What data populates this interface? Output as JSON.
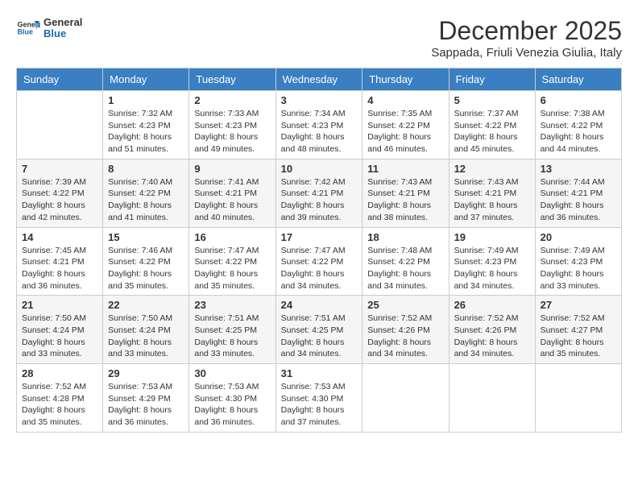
{
  "header": {
    "logo_general": "General",
    "logo_blue": "Blue",
    "month_title": "December 2025",
    "location": "Sappada, Friuli Venezia Giulia, Italy"
  },
  "days_of_week": [
    "Sunday",
    "Monday",
    "Tuesday",
    "Wednesday",
    "Thursday",
    "Friday",
    "Saturday"
  ],
  "weeks": [
    [
      {
        "day": "",
        "sunrise": "",
        "sunset": "",
        "daylight": ""
      },
      {
        "day": "1",
        "sunrise": "7:32 AM",
        "sunset": "4:23 PM",
        "daylight": "8 hours and 51 minutes."
      },
      {
        "day": "2",
        "sunrise": "7:33 AM",
        "sunset": "4:23 PM",
        "daylight": "8 hours and 49 minutes."
      },
      {
        "day": "3",
        "sunrise": "7:34 AM",
        "sunset": "4:23 PM",
        "daylight": "8 hours and 48 minutes."
      },
      {
        "day": "4",
        "sunrise": "7:35 AM",
        "sunset": "4:22 PM",
        "daylight": "8 hours and 46 minutes."
      },
      {
        "day": "5",
        "sunrise": "7:37 AM",
        "sunset": "4:22 PM",
        "daylight": "8 hours and 45 minutes."
      },
      {
        "day": "6",
        "sunrise": "7:38 AM",
        "sunset": "4:22 PM",
        "daylight": "8 hours and 44 minutes."
      }
    ],
    [
      {
        "day": "7",
        "sunrise": "7:39 AM",
        "sunset": "4:22 PM",
        "daylight": "8 hours and 42 minutes."
      },
      {
        "day": "8",
        "sunrise": "7:40 AM",
        "sunset": "4:22 PM",
        "daylight": "8 hours and 41 minutes."
      },
      {
        "day": "9",
        "sunrise": "7:41 AM",
        "sunset": "4:21 PM",
        "daylight": "8 hours and 40 minutes."
      },
      {
        "day": "10",
        "sunrise": "7:42 AM",
        "sunset": "4:21 PM",
        "daylight": "8 hours and 39 minutes."
      },
      {
        "day": "11",
        "sunrise": "7:43 AM",
        "sunset": "4:21 PM",
        "daylight": "8 hours and 38 minutes."
      },
      {
        "day": "12",
        "sunrise": "7:43 AM",
        "sunset": "4:21 PM",
        "daylight": "8 hours and 37 minutes."
      },
      {
        "day": "13",
        "sunrise": "7:44 AM",
        "sunset": "4:21 PM",
        "daylight": "8 hours and 36 minutes."
      }
    ],
    [
      {
        "day": "14",
        "sunrise": "7:45 AM",
        "sunset": "4:21 PM",
        "daylight": "8 hours and 36 minutes."
      },
      {
        "day": "15",
        "sunrise": "7:46 AM",
        "sunset": "4:22 PM",
        "daylight": "8 hours and 35 minutes."
      },
      {
        "day": "16",
        "sunrise": "7:47 AM",
        "sunset": "4:22 PM",
        "daylight": "8 hours and 35 minutes."
      },
      {
        "day": "17",
        "sunrise": "7:47 AM",
        "sunset": "4:22 PM",
        "daylight": "8 hours and 34 minutes."
      },
      {
        "day": "18",
        "sunrise": "7:48 AM",
        "sunset": "4:22 PM",
        "daylight": "8 hours and 34 minutes."
      },
      {
        "day": "19",
        "sunrise": "7:49 AM",
        "sunset": "4:23 PM",
        "daylight": "8 hours and 34 minutes."
      },
      {
        "day": "20",
        "sunrise": "7:49 AM",
        "sunset": "4:23 PM",
        "daylight": "8 hours and 33 minutes."
      }
    ],
    [
      {
        "day": "21",
        "sunrise": "7:50 AM",
        "sunset": "4:24 PM",
        "daylight": "8 hours and 33 minutes."
      },
      {
        "day": "22",
        "sunrise": "7:50 AM",
        "sunset": "4:24 PM",
        "daylight": "8 hours and 33 minutes."
      },
      {
        "day": "23",
        "sunrise": "7:51 AM",
        "sunset": "4:25 PM",
        "daylight": "8 hours and 33 minutes."
      },
      {
        "day": "24",
        "sunrise": "7:51 AM",
        "sunset": "4:25 PM",
        "daylight": "8 hours and 34 minutes."
      },
      {
        "day": "25",
        "sunrise": "7:52 AM",
        "sunset": "4:26 PM",
        "daylight": "8 hours and 34 minutes."
      },
      {
        "day": "26",
        "sunrise": "7:52 AM",
        "sunset": "4:26 PM",
        "daylight": "8 hours and 34 minutes."
      },
      {
        "day": "27",
        "sunrise": "7:52 AM",
        "sunset": "4:27 PM",
        "daylight": "8 hours and 35 minutes."
      }
    ],
    [
      {
        "day": "28",
        "sunrise": "7:52 AM",
        "sunset": "4:28 PM",
        "daylight": "8 hours and 35 minutes."
      },
      {
        "day": "29",
        "sunrise": "7:53 AM",
        "sunset": "4:29 PM",
        "daylight": "8 hours and 36 minutes."
      },
      {
        "day": "30",
        "sunrise": "7:53 AM",
        "sunset": "4:30 PM",
        "daylight": "8 hours and 36 minutes."
      },
      {
        "day": "31",
        "sunrise": "7:53 AM",
        "sunset": "4:30 PM",
        "daylight": "8 hours and 37 minutes."
      },
      {
        "day": "",
        "sunrise": "",
        "sunset": "",
        "daylight": ""
      },
      {
        "day": "",
        "sunrise": "",
        "sunset": "",
        "daylight": ""
      },
      {
        "day": "",
        "sunrise": "",
        "sunset": "",
        "daylight": ""
      }
    ]
  ],
  "labels": {
    "sunrise": "Sunrise:",
    "sunset": "Sunset:",
    "daylight": "Daylight:"
  }
}
